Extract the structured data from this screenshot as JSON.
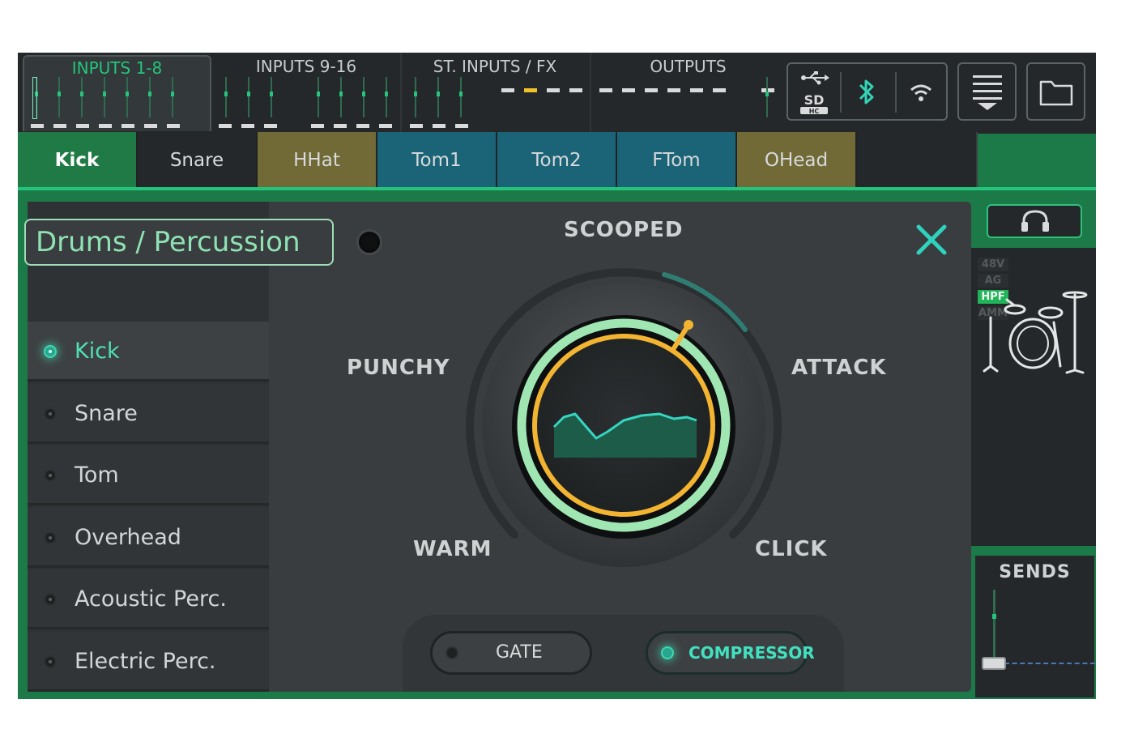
{
  "top_groups": [
    {
      "label": "INPUTS 1-8",
      "active": true
    },
    {
      "label": "INPUTS 9-16",
      "active": false
    },
    {
      "label": "ST. INPUTS / FX",
      "active": false
    },
    {
      "label": "OUTPUTS",
      "active": false
    }
  ],
  "channel_tabs": [
    {
      "label": "Kick",
      "color": "#1f7a45",
      "active": true
    },
    {
      "label": "Snare",
      "color": "#24282a"
    },
    {
      "label": "HHat",
      "color": "#716a36"
    },
    {
      "label": "Tom1",
      "color": "#1b6377"
    },
    {
      "label": "Tom2",
      "color": "#1b6377"
    },
    {
      "label": "FTom",
      "color": "#1b6377"
    },
    {
      "label": "OHead",
      "color": "#716a36"
    }
  ],
  "category": "Drums / Percussion",
  "presets": [
    {
      "label": "Kick",
      "selected": true
    },
    {
      "label": "Snare",
      "selected": false
    },
    {
      "label": "Tom",
      "selected": false
    },
    {
      "label": "Overhead",
      "selected": false
    },
    {
      "label": "Acoustic Perc.",
      "selected": false
    },
    {
      "label": "Electric Perc.",
      "selected": false
    }
  ],
  "dial": {
    "top": "SCOOPED",
    "left": "PUNCHY",
    "right": "ATTACK",
    "bottom_left": "WARM",
    "bottom_right": "CLICK"
  },
  "buttons": {
    "gate": {
      "label": "GATE",
      "on": false
    },
    "compressor": {
      "label": "COMPRESSOR",
      "on": true
    }
  },
  "status_tags": [
    {
      "label": "48V",
      "on": false
    },
    {
      "label": "AG",
      "on": false
    },
    {
      "label": "HPF",
      "on": true
    },
    {
      "label": "AMM",
      "on": false
    }
  ],
  "sends_label": "SENDS",
  "icons": [
    "usb-icon",
    "sd-card-icon",
    "bluetooth-icon",
    "wifi-icon",
    "menu-icon",
    "folder-icon",
    "close-icon",
    "headphones-icon",
    "drum-kit-icon"
  ],
  "colors": {
    "accent_green": "#25c47c",
    "teal": "#3fd7b0",
    "amber": "#f2b431",
    "mint_ring": "#9fe6b2"
  }
}
